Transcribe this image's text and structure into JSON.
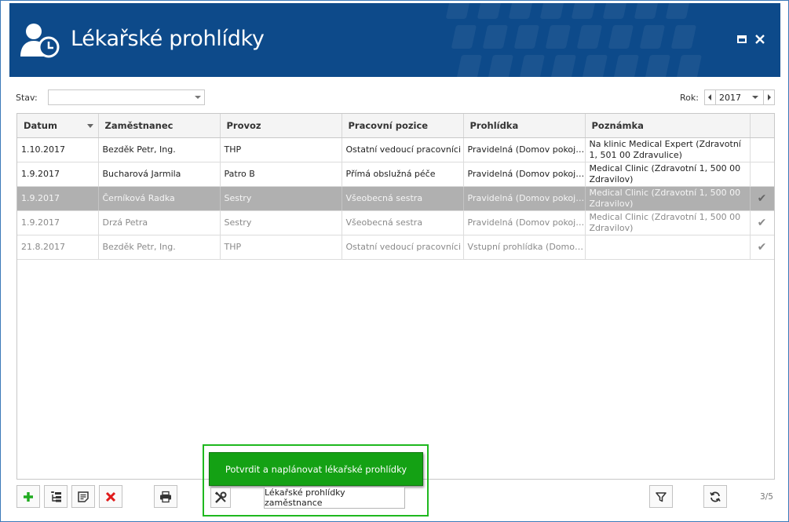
{
  "window": {
    "title": "Lékařské prohlídky"
  },
  "filters": {
    "stav_label": "Stav:",
    "stav_value": "",
    "rok_label": "Rok:",
    "rok_value": "2017"
  },
  "grid": {
    "columns": [
      "Datum",
      "Zaměstnanec",
      "Provoz",
      "Pracovní pozice",
      "Prohlídka",
      "Poznámka"
    ],
    "rows": [
      {
        "datum": "1.10.2017",
        "zamestnanec": "Bezděk Petr, Ing.",
        "provoz": "THP",
        "pozice": "Ostatní vedoucí pracovníci",
        "prohlidka": "Pravidelná (Domov pokojné stáří)",
        "poznamka": "Na klinic Medical Expert (Zdravotní 1, 501 00 Zdravulice)",
        "confirmed": false,
        "state": "normal"
      },
      {
        "datum": "1.9.2017",
        "zamestnanec": "Bucharová Jarmila",
        "provoz": "Patro B",
        "pozice": "Přímá obslužná péče",
        "prohlidka": "Pravidelná (Domov pokojné stáří)",
        "poznamka": "Medical Clinic (Zdravotní 1, 500 00 Zdravilov)",
        "confirmed": false,
        "state": "normal"
      },
      {
        "datum": "1.9.2017",
        "zamestnanec": "Černíková Radka",
        "provoz": "Sestry",
        "pozice": "Všeobecná sestra",
        "prohlidka": "Pravidelná (Domov pokojné stáří)",
        "poznamka": "Medical Clinic (Zdravotní 1, 500 00 Zdravilov)",
        "confirmed": true,
        "state": "selected"
      },
      {
        "datum": "1.9.2017",
        "zamestnanec": "Drzá Petra",
        "provoz": "Sestry",
        "pozice": "Všeobecná sestra",
        "prohlidka": "Pravidelná (Domov pokojné stáří)",
        "poznamka": "Medical Clinic (Zdravotní 1, 500 00 Zdravilov)",
        "confirmed": true,
        "state": "done"
      },
      {
        "datum": "21.8.2017",
        "zamestnanec": "Bezděk Petr, Ing.",
        "provoz": "THP",
        "pozice": "Ostatní vedoucí pracovníci",
        "prohlidka": "Vstupní prohlídka (Domov pokojné stáří)",
        "poznamka": "",
        "confirmed": true,
        "state": "done"
      }
    ],
    "check_glyph": "✔"
  },
  "toolbar": {
    "confirm_label": "Potvrdit a naplánovat lékařské prohlídky",
    "employee_label": "Lékařské prohlídky zaměstnance",
    "page_count": "3/5"
  },
  "colors": {
    "header_bg": "#0d4a8a",
    "selected_row": "#b0b0b0",
    "confirm_green": "#14a114",
    "highlight_border": "#1fb81f",
    "delete_red": "#e01b1b",
    "add_green": "#1faa1f"
  },
  "icons": [
    "user-clock-icon",
    "maximize-icon",
    "close-icon",
    "add-icon",
    "tree-add-icon",
    "edit-icon",
    "delete-icon",
    "print-icon",
    "tools-icon",
    "filter-icon",
    "refresh-icon",
    "checkmark-icon"
  ]
}
